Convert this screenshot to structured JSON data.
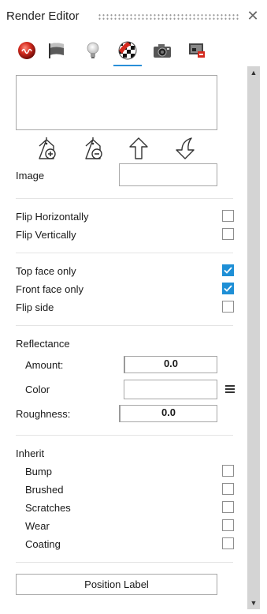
{
  "window": {
    "title": "Render Editor"
  },
  "tabs": [
    {
      "icon": "red-sphere-icon"
    },
    {
      "icon": "flag-icon"
    },
    {
      "icon": "light-bulb-icon"
    },
    {
      "icon": "checker-ball-icon",
      "active": true
    },
    {
      "icon": "camera-icon"
    },
    {
      "icon": "render-output-icon"
    }
  ],
  "image": {
    "label": "Image",
    "value": ""
  },
  "flip": {
    "horizontal_label": "Flip Horizontally",
    "horizontal": false,
    "vertical_label": "Flip Vertically",
    "vertical": false
  },
  "faces": {
    "top_label": "Top face only",
    "top": true,
    "front_label": "Front face only",
    "front": true,
    "side_label": "Flip side",
    "side": false
  },
  "reflectance": {
    "heading": "Reflectance",
    "amount_label": "Amount:",
    "amount": "0.0",
    "color_label": "Color",
    "color_value": ""
  },
  "roughness": {
    "label": "Roughness:",
    "value": "0.0"
  },
  "inherit": {
    "heading": "Inherit",
    "items": [
      {
        "label": "Bump",
        "checked": false
      },
      {
        "label": "Brushed",
        "checked": false
      },
      {
        "label": "Scratches",
        "checked": false
      },
      {
        "label": "Wear",
        "checked": false
      },
      {
        "label": "Coating",
        "checked": false
      }
    ]
  },
  "actions": {
    "position_label": "Position Label"
  },
  "colors": {
    "accent": "#2a8fd8",
    "checked": "#1e8fd6",
    "scrollbar": "#d4d4d4"
  }
}
